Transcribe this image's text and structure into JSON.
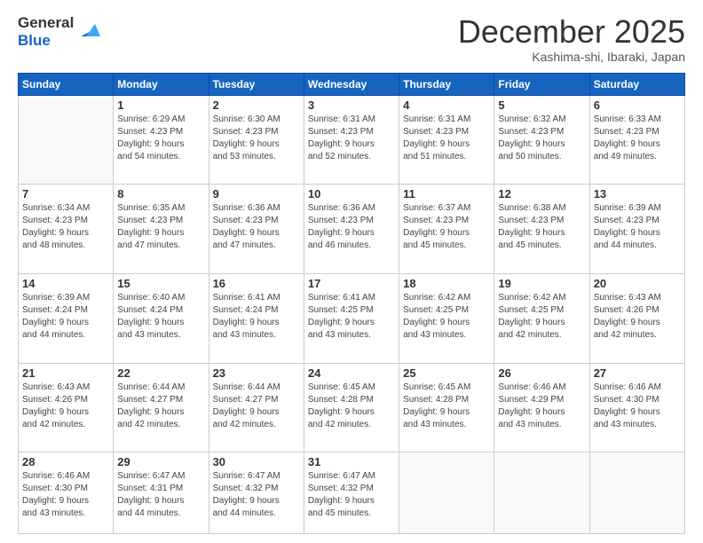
{
  "logo": {
    "general": "General",
    "blue": "Blue"
  },
  "header": {
    "month": "December 2025",
    "location": "Kashima-shi, Ibaraki, Japan"
  },
  "days_of_week": [
    "Sunday",
    "Monday",
    "Tuesday",
    "Wednesday",
    "Thursday",
    "Friday",
    "Saturday"
  ],
  "weeks": [
    [
      {
        "day": "",
        "info": ""
      },
      {
        "day": "1",
        "info": "Sunrise: 6:29 AM\nSunset: 4:23 PM\nDaylight: 9 hours\nand 54 minutes."
      },
      {
        "day": "2",
        "info": "Sunrise: 6:30 AM\nSunset: 4:23 PM\nDaylight: 9 hours\nand 53 minutes."
      },
      {
        "day": "3",
        "info": "Sunrise: 6:31 AM\nSunset: 4:23 PM\nDaylight: 9 hours\nand 52 minutes."
      },
      {
        "day": "4",
        "info": "Sunrise: 6:31 AM\nSunset: 4:23 PM\nDaylight: 9 hours\nand 51 minutes."
      },
      {
        "day": "5",
        "info": "Sunrise: 6:32 AM\nSunset: 4:23 PM\nDaylight: 9 hours\nand 50 minutes."
      },
      {
        "day": "6",
        "info": "Sunrise: 6:33 AM\nSunset: 4:23 PM\nDaylight: 9 hours\nand 49 minutes."
      }
    ],
    [
      {
        "day": "7",
        "info": "Sunrise: 6:34 AM\nSunset: 4:23 PM\nDaylight: 9 hours\nand 48 minutes."
      },
      {
        "day": "8",
        "info": "Sunrise: 6:35 AM\nSunset: 4:23 PM\nDaylight: 9 hours\nand 47 minutes."
      },
      {
        "day": "9",
        "info": "Sunrise: 6:36 AM\nSunset: 4:23 PM\nDaylight: 9 hours\nand 47 minutes."
      },
      {
        "day": "10",
        "info": "Sunrise: 6:36 AM\nSunset: 4:23 PM\nDaylight: 9 hours\nand 46 minutes."
      },
      {
        "day": "11",
        "info": "Sunrise: 6:37 AM\nSunset: 4:23 PM\nDaylight: 9 hours\nand 45 minutes."
      },
      {
        "day": "12",
        "info": "Sunrise: 6:38 AM\nSunset: 4:23 PM\nDaylight: 9 hours\nand 45 minutes."
      },
      {
        "day": "13",
        "info": "Sunrise: 6:39 AM\nSunset: 4:23 PM\nDaylight: 9 hours\nand 44 minutes."
      }
    ],
    [
      {
        "day": "14",
        "info": "Sunrise: 6:39 AM\nSunset: 4:24 PM\nDaylight: 9 hours\nand 44 minutes."
      },
      {
        "day": "15",
        "info": "Sunrise: 6:40 AM\nSunset: 4:24 PM\nDaylight: 9 hours\nand 43 minutes."
      },
      {
        "day": "16",
        "info": "Sunrise: 6:41 AM\nSunset: 4:24 PM\nDaylight: 9 hours\nand 43 minutes."
      },
      {
        "day": "17",
        "info": "Sunrise: 6:41 AM\nSunset: 4:25 PM\nDaylight: 9 hours\nand 43 minutes."
      },
      {
        "day": "18",
        "info": "Sunrise: 6:42 AM\nSunset: 4:25 PM\nDaylight: 9 hours\nand 43 minutes."
      },
      {
        "day": "19",
        "info": "Sunrise: 6:42 AM\nSunset: 4:25 PM\nDaylight: 9 hours\nand 42 minutes."
      },
      {
        "day": "20",
        "info": "Sunrise: 6:43 AM\nSunset: 4:26 PM\nDaylight: 9 hours\nand 42 minutes."
      }
    ],
    [
      {
        "day": "21",
        "info": "Sunrise: 6:43 AM\nSunset: 4:26 PM\nDaylight: 9 hours\nand 42 minutes."
      },
      {
        "day": "22",
        "info": "Sunrise: 6:44 AM\nSunset: 4:27 PM\nDaylight: 9 hours\nand 42 minutes."
      },
      {
        "day": "23",
        "info": "Sunrise: 6:44 AM\nSunset: 4:27 PM\nDaylight: 9 hours\nand 42 minutes."
      },
      {
        "day": "24",
        "info": "Sunrise: 6:45 AM\nSunset: 4:28 PM\nDaylight: 9 hours\nand 42 minutes."
      },
      {
        "day": "25",
        "info": "Sunrise: 6:45 AM\nSunset: 4:28 PM\nDaylight: 9 hours\nand 43 minutes."
      },
      {
        "day": "26",
        "info": "Sunrise: 6:46 AM\nSunset: 4:29 PM\nDaylight: 9 hours\nand 43 minutes."
      },
      {
        "day": "27",
        "info": "Sunrise: 6:46 AM\nSunset: 4:30 PM\nDaylight: 9 hours\nand 43 minutes."
      }
    ],
    [
      {
        "day": "28",
        "info": "Sunrise: 6:46 AM\nSunset: 4:30 PM\nDaylight: 9 hours\nand 43 minutes."
      },
      {
        "day": "29",
        "info": "Sunrise: 6:47 AM\nSunset: 4:31 PM\nDaylight: 9 hours\nand 44 minutes."
      },
      {
        "day": "30",
        "info": "Sunrise: 6:47 AM\nSunset: 4:32 PM\nDaylight: 9 hours\nand 44 minutes."
      },
      {
        "day": "31",
        "info": "Sunrise: 6:47 AM\nSunset: 4:32 PM\nDaylight: 9 hours\nand 45 minutes."
      },
      {
        "day": "",
        "info": ""
      },
      {
        "day": "",
        "info": ""
      },
      {
        "day": "",
        "info": ""
      }
    ]
  ]
}
